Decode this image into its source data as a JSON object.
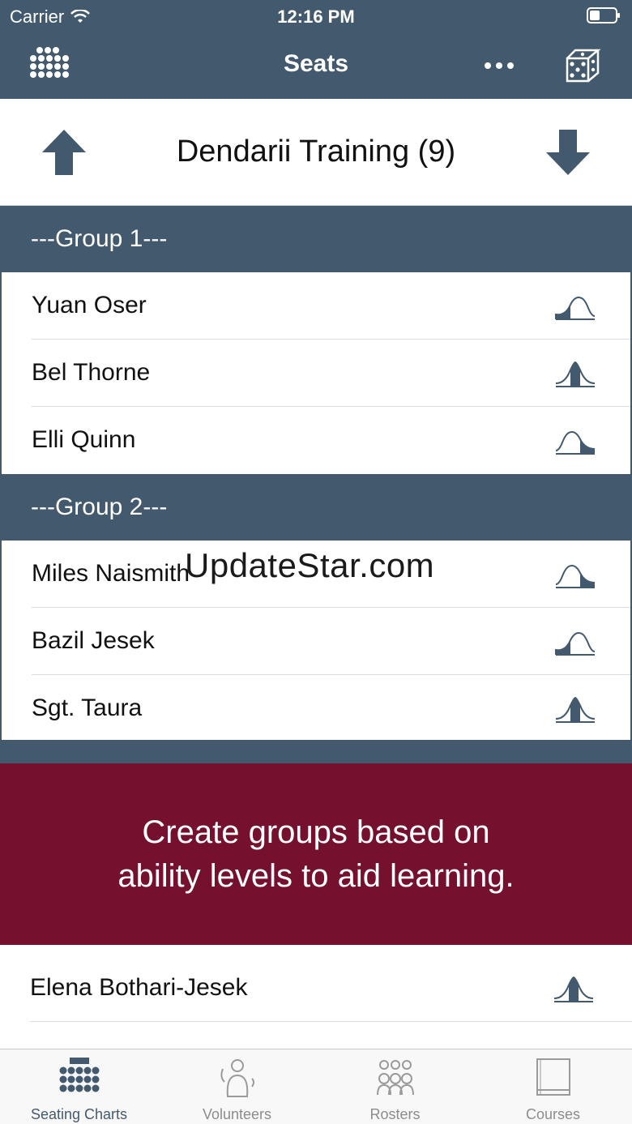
{
  "status_bar": {
    "carrier": "Carrier",
    "time": "12:16 PM"
  },
  "nav": {
    "title": "Seats"
  },
  "class_header": {
    "title": "Dendarii Training (9)"
  },
  "groups": [
    {
      "label": "---Group 1---",
      "students": [
        {
          "name": "Yuan Oser",
          "ability": "low"
        },
        {
          "name": "Bel Thorne",
          "ability": "mid"
        },
        {
          "name": "Elli Quinn",
          "ability": "high"
        }
      ]
    },
    {
      "label": "---Group 2---",
      "students": [
        {
          "name": "Miles Naismith",
          "ability": "high"
        },
        {
          "name": "Bazil Jesek",
          "ability": "low"
        },
        {
          "name": "Sgt. Taura",
          "ability": "mid"
        }
      ]
    }
  ],
  "banner": {
    "line1": "Create groups based on",
    "line2": "ability levels to aid learning."
  },
  "tail_student": {
    "name": "Elena Bothari-Jesek",
    "ability": "mid"
  },
  "watermark": "UpdateStar.com",
  "tabs": [
    {
      "label": "Seating Charts",
      "icon": "seating-chart-icon",
      "active": true
    },
    {
      "label": "Volunteers",
      "icon": "volunteer-icon",
      "active": false
    },
    {
      "label": "Rosters",
      "icon": "roster-icon",
      "active": false
    },
    {
      "label": "Courses",
      "icon": "book-icon",
      "active": false
    }
  ],
  "colors": {
    "nav": "#435a6e",
    "banner": "#75112e",
    "accent": "#435a6e"
  }
}
